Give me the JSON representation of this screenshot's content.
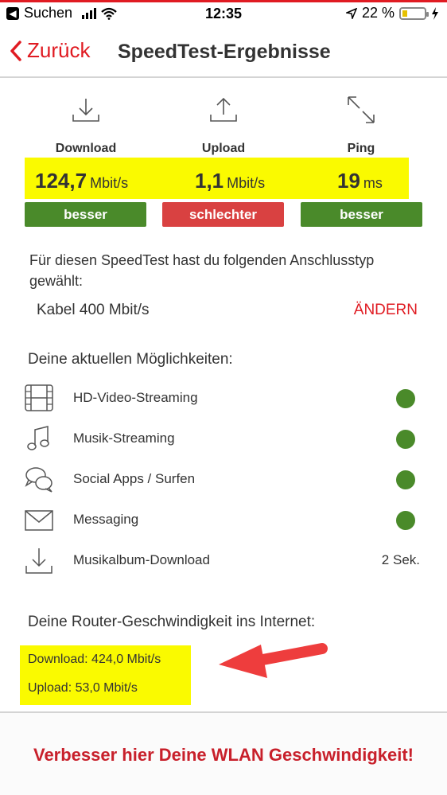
{
  "status_bar": {
    "back_app": "Suchen",
    "time": "12:35",
    "battery": "22 %"
  },
  "nav": {
    "back_label": "Zurück",
    "title": "SpeedTest-Ergebnisse"
  },
  "metrics": [
    {
      "label": "Download",
      "value": "124,7",
      "unit": "Mbit/s",
      "rating": "besser",
      "rating_color": "#4a8a2a",
      "icon": "download-icon"
    },
    {
      "label": "Upload",
      "value": "1,1",
      "unit": "Mbit/s",
      "rating": "schlechter",
      "rating_color": "#d94141",
      "icon": "upload-icon"
    },
    {
      "label": "Ping",
      "value": "19",
      "unit": "ms",
      "rating": "besser",
      "rating_color": "#4a8a2a",
      "icon": "ping-icon"
    }
  ],
  "connection": {
    "description": "Für diesen SpeedTest hast du folgenden Anschlusstyp gewählt:",
    "type": "Kabel 400 Mbit/s",
    "change_label": "ÄNDERN"
  },
  "capabilities": {
    "title": "Deine aktuellen Möglichkeiten:",
    "items": [
      {
        "label": "HD-Video-Streaming",
        "icon": "film-icon",
        "status": "ok"
      },
      {
        "label": "Musik-Streaming",
        "icon": "music-note-icon",
        "status": "ok"
      },
      {
        "label": "Social Apps / Surfen",
        "icon": "chat-bubbles-icon",
        "status": "ok"
      },
      {
        "label": "Messaging",
        "icon": "envelope-icon",
        "status": "ok"
      },
      {
        "label": "Musikalbum-Download",
        "icon": "download-icon",
        "time": "2 Sek."
      }
    ]
  },
  "router": {
    "title": "Deine Router-Geschwindigkeit ins Internet:",
    "download": "Download: 424,0 Mbit/s",
    "upload": "Upload: 53,0 Mbit/s"
  },
  "cta": {
    "label": "Verbesser hier Deine WLAN Geschwindigkeit!"
  },
  "colors": {
    "accent": "#e01b22",
    "highlight": "#fafa00",
    "good": "#4a8a2a",
    "bad": "#d94141"
  }
}
